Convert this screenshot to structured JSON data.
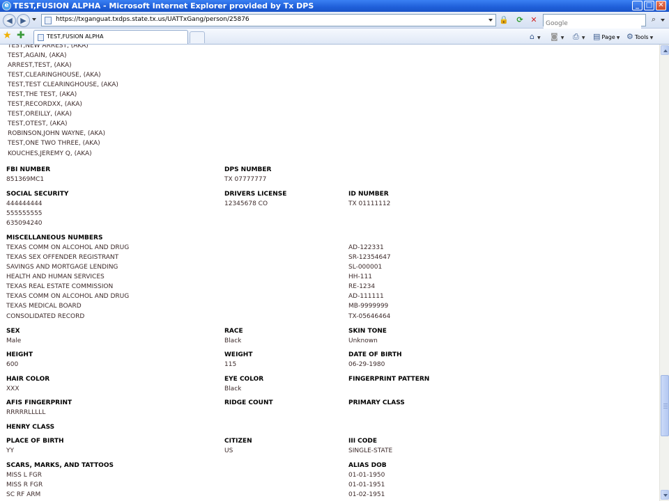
{
  "window": {
    "title": "TEST,FUSION ALPHA - Microsoft Internet Explorer provided by Tx DPS",
    "min": "_",
    "max": "□",
    "close": "✕"
  },
  "address_bar": {
    "url": "https://txganguat.txdps.state.tx.us/UATTxGang/person/25876",
    "search_placeholder": "Google"
  },
  "tab": {
    "label": "TEST,FUSION ALPHA"
  },
  "commands": {
    "page": "Page",
    "tools": "Tools"
  },
  "aliases": [
    "TEST,NEW ARREST, (AKA)",
    "TEST,AGAIN, (AKA)",
    "ARREST,TEST, (AKA)",
    "TEST,CLEARINGHOUSE, (AKA)",
    "TEST,TEST CLEARINGHOUSE, (AKA)",
    "TEST,THE TEST, (AKA)",
    "TEST,RECORDXX, (AKA)",
    "TEST,OREILLY, (AKA)",
    "TEST,OTEST, (AKA)",
    "ROBINSON,JOHN WAYNE, (AKA)",
    "TEST,ONE TWO THREE, (AKA)",
    "KOUCHES,JEREMY Q, (AKA)"
  ],
  "fbi": {
    "label": "FBI NUMBER",
    "value": "851369MC1"
  },
  "dps": {
    "label": "DPS NUMBER",
    "value": "TX 07777777"
  },
  "ssn": {
    "label": "SOCIAL SECURITY",
    "values": [
      "444444444",
      "555555555",
      "635094240"
    ]
  },
  "dl": {
    "label": "DRIVERS LICENSE",
    "value": "12345678 CO"
  },
  "idnum": {
    "label": "ID NUMBER",
    "value": "TX 01111112"
  },
  "misc": {
    "label": "MISCELLANEOUS NUMBERS",
    "items": [
      {
        "agency": "TEXAS COMM ON ALCOHOL AND DRUG",
        "number": "AD-122331"
      },
      {
        "agency": "TEXAS SEX OFFENDER REGISTRANT",
        "number": "SR-12354647"
      },
      {
        "agency": "SAVINGS AND MORTGAGE LENDING",
        "number": "SL-000001"
      },
      {
        "agency": "HEALTH AND HUMAN SERVICES",
        "number": "HH-111"
      },
      {
        "agency": "TEXAS REAL ESTATE COMMISSION",
        "number": "RE-1234"
      },
      {
        "agency": "TEXAS COMM ON ALCOHOL AND DRUG",
        "number": "AD-111111"
      },
      {
        "agency": "TEXAS MEDICAL BOARD",
        "number": "MB-9999999"
      },
      {
        "agency": "CONSOLIDATED RECORD",
        "number": "TX-05646464"
      }
    ]
  },
  "sex": {
    "label": "SEX",
    "value": "Male"
  },
  "race": {
    "label": "RACE",
    "value": "Black"
  },
  "skin": {
    "label": "SKIN TONE",
    "value": "Unknown"
  },
  "height": {
    "label": "HEIGHT",
    "value": "600"
  },
  "weight": {
    "label": "WEIGHT",
    "value": "115"
  },
  "dob": {
    "label": "DATE OF BIRTH",
    "value": "06-29-1980"
  },
  "hair": {
    "label": "HAIR COLOR",
    "value": "XXX"
  },
  "eye": {
    "label": "EYE COLOR",
    "value": "Black"
  },
  "fpp": {
    "label": "FINGERPRINT PATTERN",
    "value": ""
  },
  "afis": {
    "label": "AFIS FINGERPRINT",
    "value": "RRRRRLLLLL"
  },
  "ridge": {
    "label": "RIDGE COUNT",
    "value": ""
  },
  "primary": {
    "label": "PRIMARY CLASS",
    "value": ""
  },
  "henry": {
    "label": "HENRY CLASS",
    "value": ""
  },
  "pob": {
    "label": "PLACE OF BIRTH",
    "value": "YY"
  },
  "citizen": {
    "label": "CITIZEN",
    "value": "US"
  },
  "iii": {
    "label": "III CODE",
    "value": "SINGLE-STATE"
  },
  "smt": {
    "label": "SCARS, MARKS, AND TATTOOS",
    "values": [
      "MISS L FGR",
      "MISS R FGR",
      "SC RF ARM"
    ]
  },
  "aliasdob": {
    "label": "ALIAS DOB",
    "values": [
      "01-01-1950",
      "01-01-1951",
      "01-02-1951"
    ]
  }
}
